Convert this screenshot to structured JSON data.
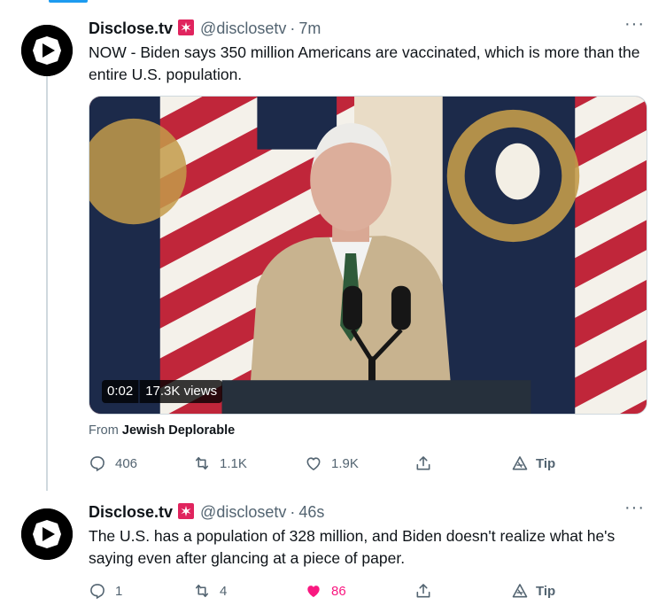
{
  "tweets": [
    {
      "display_name": "Disclose.tv",
      "badge_icon": "rotating-light-icon",
      "handle": "@disclosetv",
      "separator": "·",
      "time": "7m",
      "more": "···",
      "text": "NOW - Biden says 350 million Americans are vaccinated, which is more than the entire U.S. population.",
      "video": {
        "duration": "0:02",
        "views": "17.3K views"
      },
      "from_prefix": "From",
      "from_name": "Jewish Deplorable",
      "actions": {
        "reply": "406",
        "retweet": "1.1K",
        "like": "1.9K",
        "tip": "Tip"
      }
    },
    {
      "display_name": "Disclose.tv",
      "badge_icon": "rotating-light-icon",
      "handle": "@disclosetv",
      "separator": "·",
      "time": "46s",
      "more": "···",
      "text": "The U.S. has a population of 328 million, and Biden doesn't realize what he's saying even after glancing at a piece of paper.",
      "actions": {
        "reply": "1",
        "retweet": "4",
        "like": "86",
        "tip": "Tip"
      }
    }
  ],
  "colors": {
    "text": "#0f1419",
    "secondary": "#536471",
    "like_active": "#f91880",
    "thread_line": "#cfd9de",
    "accent": "#1d9bf0"
  }
}
